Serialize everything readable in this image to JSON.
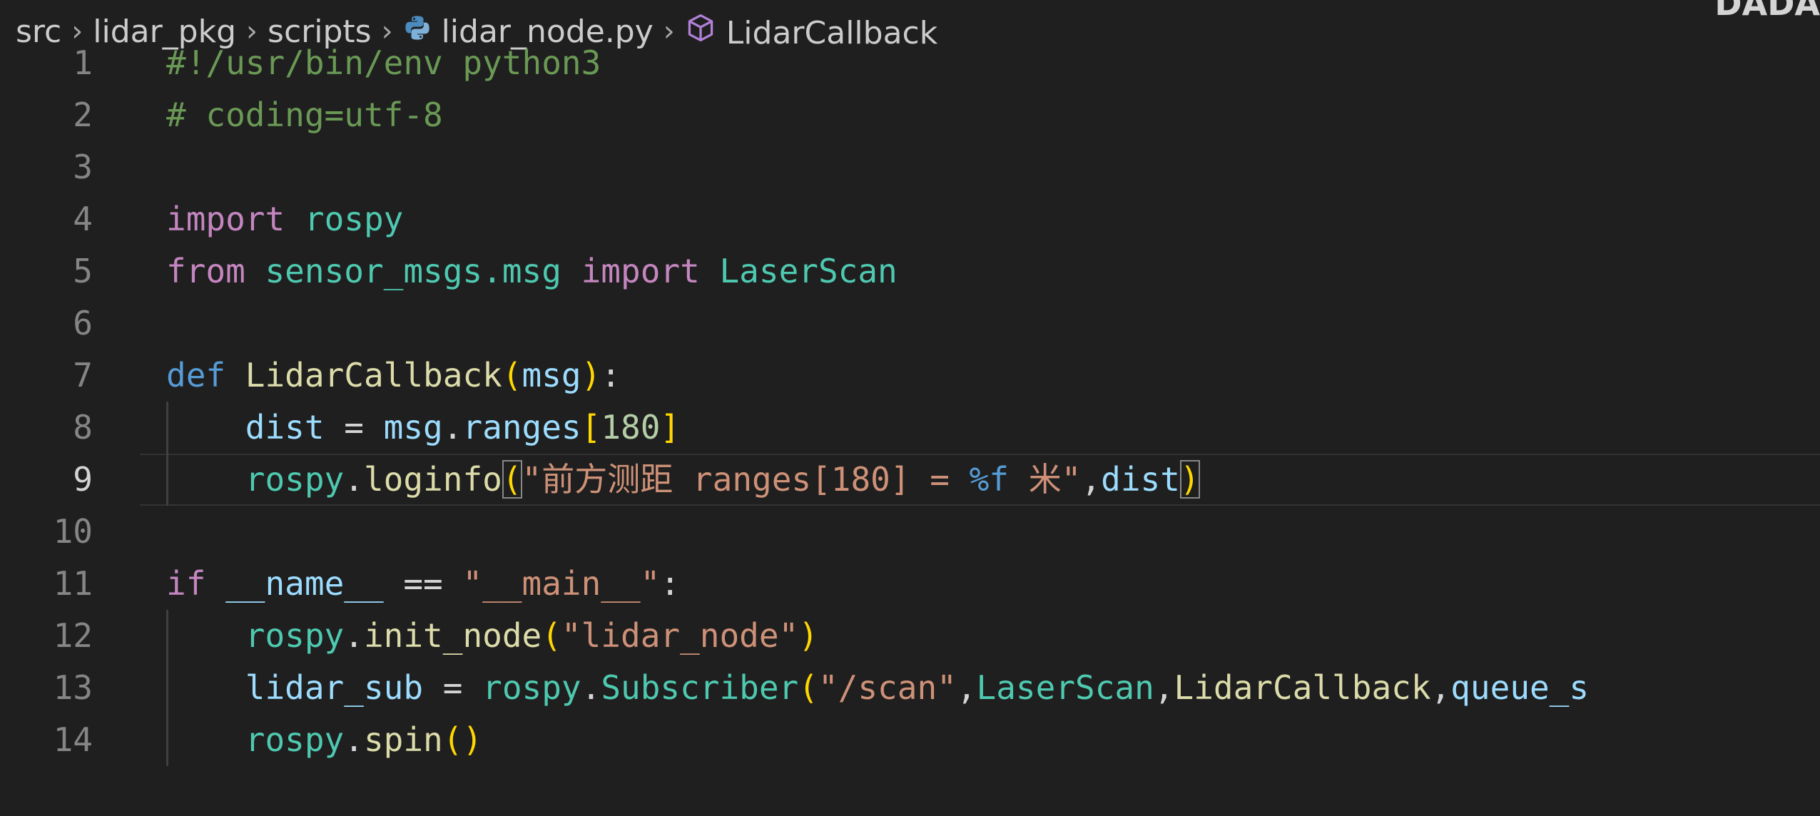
{
  "watermark": "DADA",
  "breadcrumb": {
    "items": [
      "src",
      "lidar_pkg",
      "scripts",
      "lidar_node.py",
      "LidarCallback"
    ],
    "separator": "›",
    "file_icon": "python-file-icon",
    "symbol_icon": "symbol-class-icon"
  },
  "editor": {
    "current_line": 9,
    "lines": [
      {
        "num": "1",
        "tokens": [
          {
            "t": "#!/usr/bin/env python3",
            "c": "comment"
          }
        ]
      },
      {
        "num": "2",
        "tokens": [
          {
            "t": "# coding=utf-8",
            "c": "comment"
          }
        ]
      },
      {
        "num": "3",
        "tokens": []
      },
      {
        "num": "4",
        "tokens": [
          {
            "t": "import",
            "c": "keyword"
          },
          {
            "t": " ",
            "c": "punct"
          },
          {
            "t": "rospy",
            "c": "module"
          }
        ]
      },
      {
        "num": "5",
        "tokens": [
          {
            "t": "from",
            "c": "keyword"
          },
          {
            "t": " ",
            "c": "punct"
          },
          {
            "t": "sensor_msgs.msg",
            "c": "module"
          },
          {
            "t": " ",
            "c": "punct"
          },
          {
            "t": "import",
            "c": "keyword"
          },
          {
            "t": " ",
            "c": "punct"
          },
          {
            "t": "LaserScan",
            "c": "class"
          }
        ]
      },
      {
        "num": "6",
        "tokens": []
      },
      {
        "num": "7",
        "tokens": [
          {
            "t": "def",
            "c": "storage"
          },
          {
            "t": " ",
            "c": "punct"
          },
          {
            "t": "LidarCallback",
            "c": "func"
          },
          {
            "t": "(",
            "c": "bracket"
          },
          {
            "t": "msg",
            "c": "var"
          },
          {
            "t": ")",
            "c": "bracket"
          },
          {
            "t": ":",
            "c": "punct"
          }
        ]
      },
      {
        "num": "8",
        "tokens": [
          {
            "t": "    ",
            "c": "punct"
          },
          {
            "t": "dist",
            "c": "var"
          },
          {
            "t": " = ",
            "c": "punct"
          },
          {
            "t": "msg",
            "c": "var"
          },
          {
            "t": ".",
            "c": "punct"
          },
          {
            "t": "ranges",
            "c": "var"
          },
          {
            "t": "[",
            "c": "bracket"
          },
          {
            "t": "180",
            "c": "number"
          },
          {
            "t": "]",
            "c": "bracket"
          }
        ]
      },
      {
        "num": "9",
        "tokens": [
          {
            "t": "    ",
            "c": "punct"
          },
          {
            "t": "rospy",
            "c": "module"
          },
          {
            "t": ".",
            "c": "punct"
          },
          {
            "t": "loginfo",
            "c": "func"
          },
          {
            "t": "(",
            "c": "bracket box"
          },
          {
            "t": "\"前方测距 ranges[180] = ",
            "c": "string"
          },
          {
            "t": "%f",
            "c": "fmt"
          },
          {
            "t": " 米\"",
            "c": "string"
          },
          {
            "t": ",",
            "c": "punct"
          },
          {
            "t": "dist",
            "c": "var"
          },
          {
            "t": ")",
            "c": "bracket box"
          }
        ]
      },
      {
        "num": "10",
        "tokens": []
      },
      {
        "num": "11",
        "tokens": [
          {
            "t": "if",
            "c": "keyword"
          },
          {
            "t": " ",
            "c": "punct"
          },
          {
            "t": "__name__",
            "c": "var"
          },
          {
            "t": " == ",
            "c": "punct"
          },
          {
            "t": "\"__main__\"",
            "c": "string"
          },
          {
            "t": ":",
            "c": "punct"
          }
        ]
      },
      {
        "num": "12",
        "tokens": [
          {
            "t": "    ",
            "c": "punct"
          },
          {
            "t": "rospy",
            "c": "module"
          },
          {
            "t": ".",
            "c": "punct"
          },
          {
            "t": "init_node",
            "c": "func"
          },
          {
            "t": "(",
            "c": "bracket"
          },
          {
            "t": "\"lidar_node\"",
            "c": "string"
          },
          {
            "t": ")",
            "c": "bracket"
          }
        ]
      },
      {
        "num": "13",
        "tokens": [
          {
            "t": "    ",
            "c": "punct"
          },
          {
            "t": "lidar_sub",
            "c": "var"
          },
          {
            "t": " = ",
            "c": "punct"
          },
          {
            "t": "rospy",
            "c": "module"
          },
          {
            "t": ".",
            "c": "punct"
          },
          {
            "t": "Subscriber",
            "c": "class"
          },
          {
            "t": "(",
            "c": "bracket"
          },
          {
            "t": "\"/scan\"",
            "c": "string"
          },
          {
            "t": ",",
            "c": "punct"
          },
          {
            "t": "LaserScan",
            "c": "class"
          },
          {
            "t": ",",
            "c": "punct"
          },
          {
            "t": "LidarCallback",
            "c": "func"
          },
          {
            "t": ",",
            "c": "punct"
          },
          {
            "t": "queue_s",
            "c": "var"
          }
        ]
      },
      {
        "num": "14",
        "tokens": [
          {
            "t": "    ",
            "c": "punct"
          },
          {
            "t": "rospy",
            "c": "module"
          },
          {
            "t": ".",
            "c": "punct"
          },
          {
            "t": "spin",
            "c": "func"
          },
          {
            "t": "(",
            "c": "bracket"
          },
          {
            "t": ")",
            "c": "bracket"
          }
        ]
      }
    ]
  }
}
